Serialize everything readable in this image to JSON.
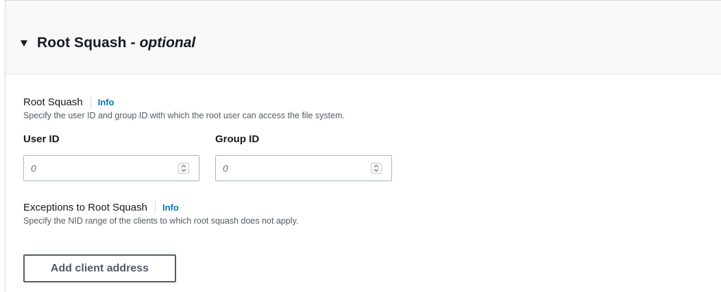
{
  "panel": {
    "title": "Root Squash",
    "separator": "-",
    "title_suffix": "optional"
  },
  "root_squash": {
    "label": "Root Squash",
    "info_link": "Info",
    "description": "Specify the user ID and group ID with which the root user can access the file system.",
    "user_id": {
      "label": "User ID",
      "placeholder": "0"
    },
    "group_id": {
      "label": "Group ID",
      "placeholder": "0"
    }
  },
  "exceptions": {
    "label": "Exceptions to Root Squash",
    "info_link": "Info",
    "description": "Specify the NID range of the clients to which root squash does not apply.",
    "add_button_label": "Add client address"
  },
  "icons": {
    "expand": "caret-down-icon",
    "stepper": "stepper-icon"
  },
  "colors": {
    "link": "#0073bb",
    "header_bg": "#f8f8f8",
    "border": "#aab7b8",
    "button_border": "#545b64"
  }
}
